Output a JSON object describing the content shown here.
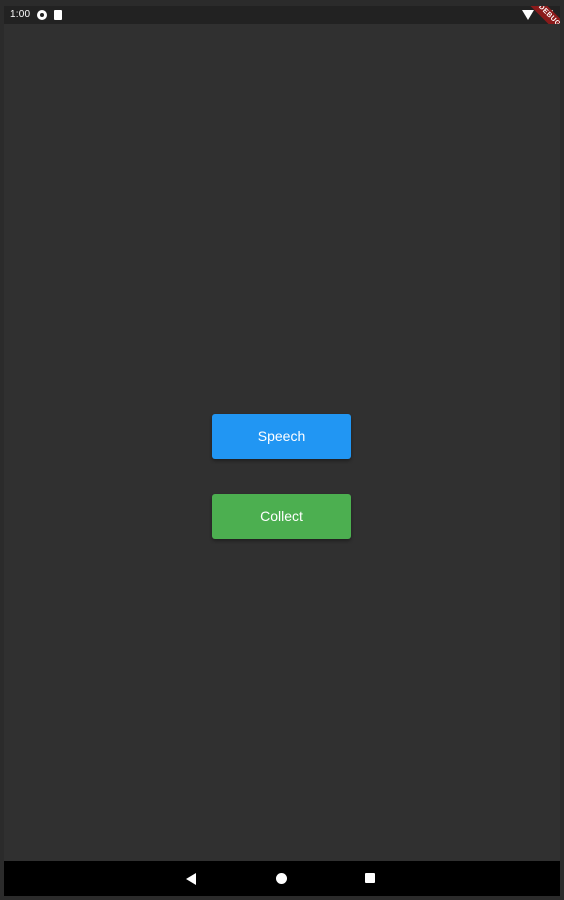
{
  "status_bar": {
    "time": "1:00",
    "icons": [
      "notification-icon",
      "sim-card-icon",
      "wifi-icon",
      "battery-icon"
    ]
  },
  "debug_banner": {
    "label": "DEBUG"
  },
  "main": {
    "buttons": {
      "speech": {
        "label": "Speech",
        "color": "#2196f3"
      },
      "collect": {
        "label": "Collect",
        "color": "#4caf50"
      }
    }
  },
  "nav_bar": {
    "icons": [
      "back-icon",
      "home-icon",
      "recents-icon"
    ]
  },
  "colors": {
    "background": "#303030",
    "status_bar": "#222222",
    "nav_bar": "#000000"
  }
}
